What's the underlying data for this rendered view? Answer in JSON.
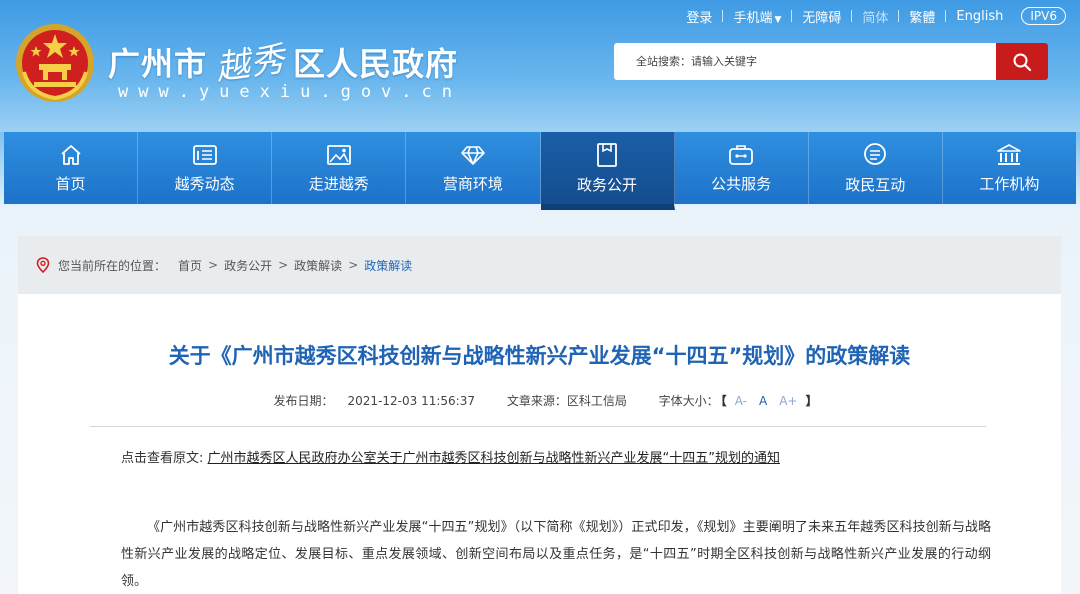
{
  "topbar": {
    "login": "登录",
    "mobile": "手机端",
    "accessible": "无障碍",
    "simplified": "简体",
    "traditional": "繁體",
    "english": "English",
    "ipv6": "IPV6"
  },
  "header": {
    "site_name_prefix": "广州市",
    "site_name_calligraphy": "越秀",
    "site_name_suffix": "区人民政府",
    "site_url": "www.yuexiu.gov.cn"
  },
  "search": {
    "placeholder": "全站搜索：请输入关键字"
  },
  "nav": {
    "items": [
      {
        "label": "首页",
        "icon": "home-icon"
      },
      {
        "label": "越秀动态",
        "icon": "news-icon"
      },
      {
        "label": "走进越秀",
        "icon": "picture-icon"
      },
      {
        "label": "营商环境",
        "icon": "diamond-icon"
      },
      {
        "label": "政务公开",
        "icon": "folder-icon"
      },
      {
        "label": "公共服务",
        "icon": "briefcase-icon"
      },
      {
        "label": "政民互动",
        "icon": "chat-icon"
      },
      {
        "label": "工作机构",
        "icon": "building-icon"
      }
    ],
    "active_index": 4
  },
  "breadcrumb": {
    "label": "您当前所在的位置：",
    "items": [
      "首页",
      "政务公开",
      "政策解读",
      "政策解读"
    ]
  },
  "article": {
    "title": "关于《广州市越秀区科技创新与战略性新兴产业发展“十四五”规划》的政策解读",
    "date_label": "发布日期：",
    "date": "2021-12-03 11:56:37",
    "source_label": "文章来源：",
    "source": "区科工信局",
    "fontsize_label": "字体大小：",
    "fontsize_small": "A-",
    "fontsize_normal": "A",
    "fontsize_large": "A+",
    "bracket_open": "【",
    "bracket_close": "】",
    "original_label": "点击查看原文:",
    "original_link": "广州市越秀区人民政府办公室关于广州市越秀区科技创新与战略性新兴产业发展“十四五”规划的通知",
    "paragraph": "《广州市越秀区科技创新与战略性新兴产业发展“十四五”规划》（以下简称《规划》）正式印发，《规划》主要阐明了未来五年越秀区科技创新与战略性新兴产业发展的战略定位、发展目标、重点发展领域、创新空间布局以及重点任务，是“十四五”时期全区科技创新与战略性新兴产业发展的行动纲领。"
  },
  "colors": {
    "header_blue": "#3f9be4",
    "nav_blue": "#1d72c9",
    "nav_active": "#144d8e",
    "search_red": "#c81c1c",
    "title_blue": "#1f63b4"
  }
}
